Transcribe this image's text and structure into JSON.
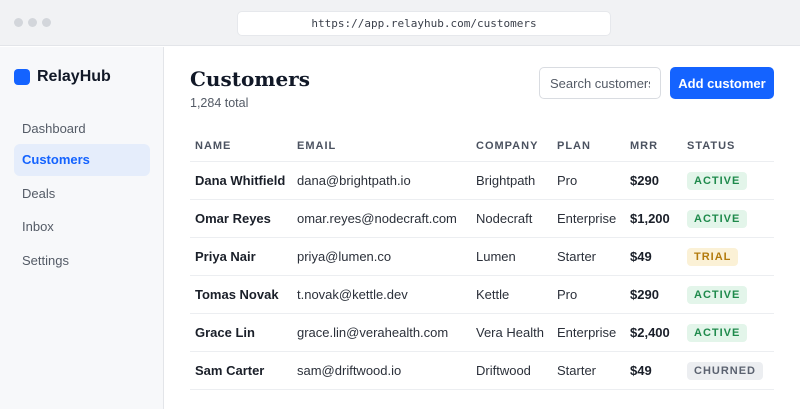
{
  "browser": {
    "url": "https://app.relayhub.com/customers"
  },
  "sidebar": {
    "brand": "RelayHub",
    "items": [
      {
        "label": "Dashboard"
      },
      {
        "label": "Customers"
      },
      {
        "label": "Deals"
      },
      {
        "label": "Inbox"
      },
      {
        "label": "Settings"
      }
    ],
    "active_item": "Customers"
  },
  "page": {
    "title": "Customers",
    "subtitle": "1,284 total",
    "search_placeholder": "Search customers",
    "add_button": "Add customer"
  },
  "table": {
    "columns": [
      "NAME",
      "EMAIL",
      "COMPANY",
      "PLAN",
      "MRR",
      "STATUS"
    ],
    "rows": [
      {
        "name": "Dana Whitfield",
        "email": "dana@brightpath.io",
        "company": "Brightpath",
        "plan": "Pro",
        "mrr": "$290",
        "status": "ACTIVE"
      },
      {
        "name": "Omar Reyes",
        "email": "omar.reyes@nodecraft.com",
        "company": "Nodecraft",
        "plan": "Enterprise",
        "mrr": "$1,200",
        "status": "ACTIVE"
      },
      {
        "name": "Priya Nair",
        "email": "priya@lumen.co",
        "company": "Lumen",
        "plan": "Starter",
        "mrr": "$49",
        "status": "TRIAL"
      },
      {
        "name": "Tomas Novak",
        "email": "t.novak@kettle.dev",
        "company": "Kettle",
        "plan": "Pro",
        "mrr": "$290",
        "status": "ACTIVE"
      },
      {
        "name": "Grace Lin",
        "email": "grace.lin@verahealth.com",
        "company": "Vera Health",
        "plan": "Enterprise",
        "mrr": "$2,400",
        "status": "ACTIVE"
      },
      {
        "name": "Sam Carter",
        "email": "sam@driftwood.io",
        "company": "Driftwood",
        "plan": "Starter",
        "mrr": "$49",
        "status": "CHURNED"
      }
    ]
  },
  "colors": {
    "accent": "#1463ff",
    "status_active": "#1f8a4c",
    "status_trial": "#b37a0c",
    "status_churned": "#5b6270"
  },
  "icons": {
    "logo": "brand-logo-icon"
  }
}
